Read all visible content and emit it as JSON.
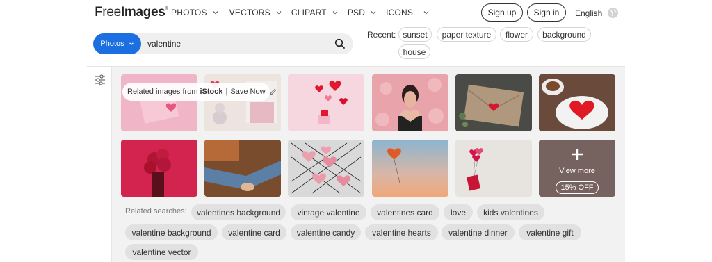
{
  "header": {
    "logo_free": "Free",
    "logo_images": "Images",
    "logo_mark": "®",
    "nav": [
      "PHOTOS",
      "VECTORS",
      "CLIPART",
      "PSD",
      "ICONS"
    ],
    "sign_up": "Sign up",
    "sign_in": "Sign in",
    "language": "English"
  },
  "search": {
    "type_label": "Photos",
    "value": "valentine",
    "accent_color": "#1c6fe0"
  },
  "recent": {
    "label": "Recent:",
    "items": [
      "sunset",
      "paper texture",
      "flower",
      "background",
      "house"
    ]
  },
  "results": {
    "banner_prefix": "Related images from",
    "banner_brand": "iStock",
    "banner_separator": "|",
    "banner_action": "Save Now",
    "view_more": "View more",
    "discount": "15% OFF",
    "images": [
      "pink-heart-envelope-photo",
      "pink-teddy-room-photo",
      "red-hearts-gift-photo",
      "woman-heart-hands-photo",
      "envelope-red-heart-photo",
      "heart-cake-coffee-photo",
      "red-balloons-couple-photo",
      "couple-legs-fireplace-photo",
      "heart-cookies-rack-photo",
      "heart-balloon-sky-photo",
      "heart-balloons-gift-photo"
    ]
  },
  "related": {
    "label": "Related searches:",
    "items": [
      "valentines background",
      "vintage valentine",
      "valentines card",
      "love",
      "kids valentines",
      "valentine background",
      "valentine card",
      "valentine candy",
      "valentine hearts",
      "valentine dinner",
      "valentine gift",
      "valentine vector"
    ]
  }
}
